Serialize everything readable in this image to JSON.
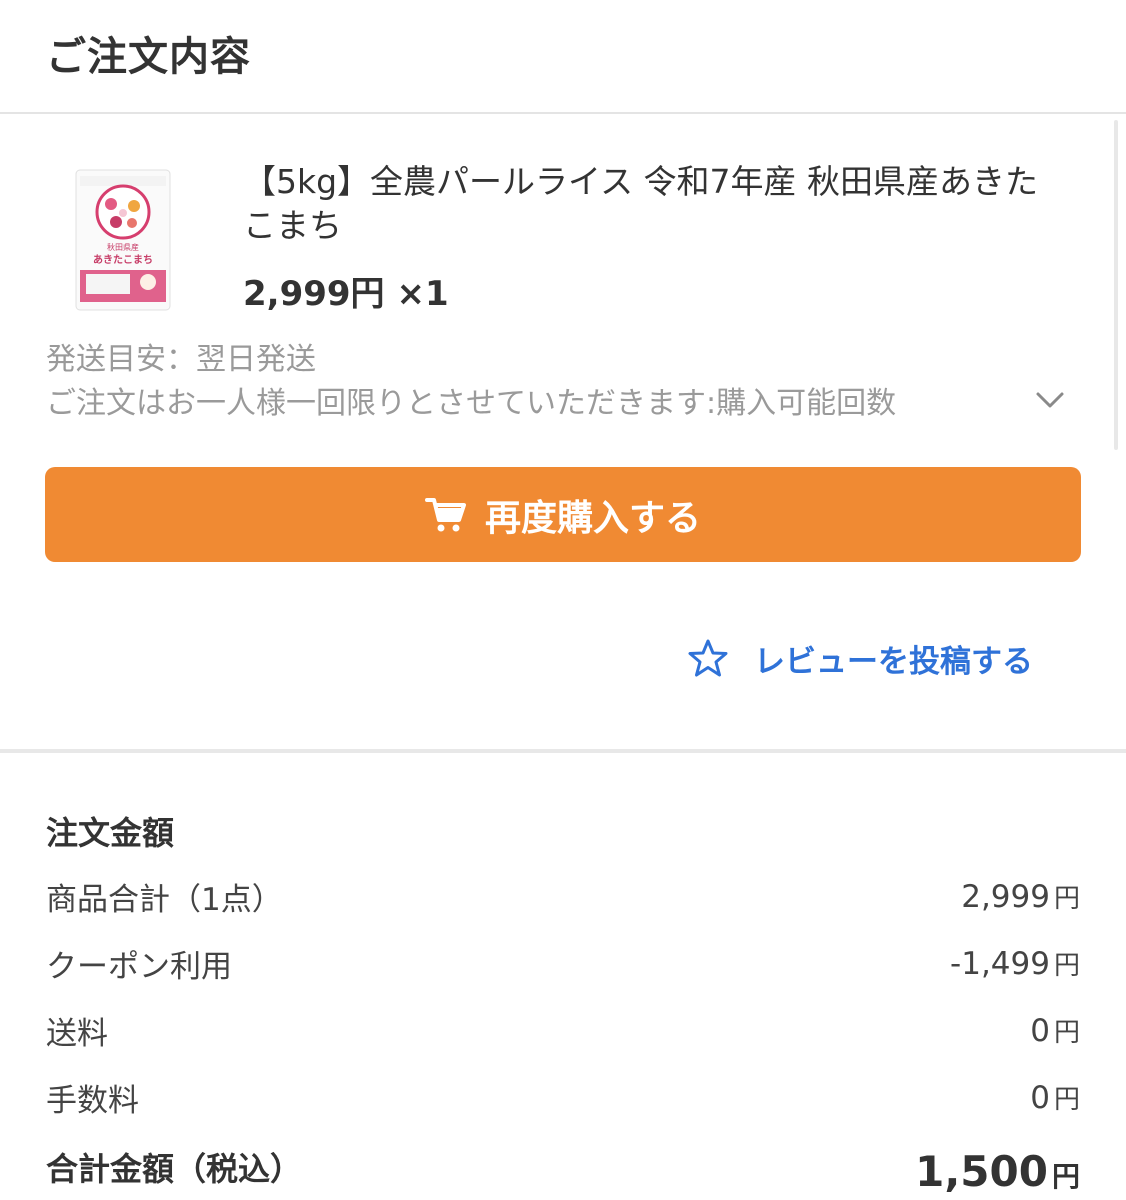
{
  "page_title": "ご注文内容",
  "product": {
    "name": "【5kg】全農パールライス 令和7年産 秋田県産あきたこまち",
    "price": "2,999円",
    "quantity": "×1",
    "shipping": "発送目安：翌日発送",
    "limit_note": "ご注文はお一人様一回限りとさせていただきます:購入可能回数",
    "image_label_line1": "秋田県産",
    "image_label_line2": "あきたこまち"
  },
  "buy_again_label": "再度購入する",
  "review_label": "レビューを投稿する",
  "summary": {
    "heading": "注文金額",
    "yen": "円",
    "rows": [
      {
        "label": "商品合計（1点）",
        "value": "2,999"
      },
      {
        "label": "クーポン利用",
        "value": "-1,499"
      },
      {
        "label": "送料",
        "value": "0"
      },
      {
        "label": "手数料",
        "value": "0"
      }
    ],
    "total_label": "合計金額（税込）",
    "total_value": "1,500"
  },
  "colors": {
    "accent_orange": "#f08a33",
    "link_blue": "#2f72d8",
    "muted_text": "#9a9a9a"
  },
  "icons": [
    "cart-icon",
    "star-icon",
    "chevron-down-icon"
  ]
}
